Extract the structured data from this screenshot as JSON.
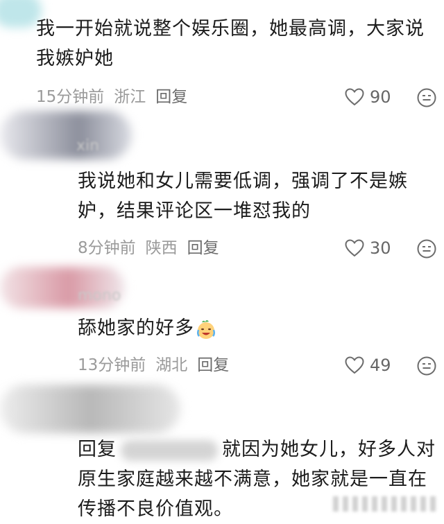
{
  "comments": [
    {
      "text_lines": [
        "我一开始就说整个娱乐圈，她最高调，大家说",
        "我嫉妒她"
      ],
      "time": "15分钟前",
      "location": "浙江",
      "reply": "回复",
      "likes": "90"
    },
    {
      "username": "xin",
      "text_lines": [
        "我说她和女儿需要低调，强调了不是嫉",
        "妒，结果评论区一堆怼我的"
      ],
      "time": "8分钟前",
      "location": "陕西",
      "reply": "回复",
      "likes": "30"
    },
    {
      "username": "mono",
      "text_lines": [
        "舔她家的好多"
      ],
      "time": "13分钟前",
      "location": "湖北",
      "reply": "回复",
      "likes": "49"
    },
    {
      "text_lines": [
        "回复",
        "就因为她女儿，好多人对",
        "原生家庭越来越不满意，她家就是一直在",
        "传播不良价值观。"
      ]
    }
  ],
  "icons": {
    "like": "heart-outline-icon",
    "emoji": "smiley-face-icon",
    "inline_emoji": "crying-laughing-emoji"
  },
  "colors": {
    "text": "#1c1c1c",
    "meta": "#9a9a9a",
    "icon": "#6b6b6b"
  }
}
